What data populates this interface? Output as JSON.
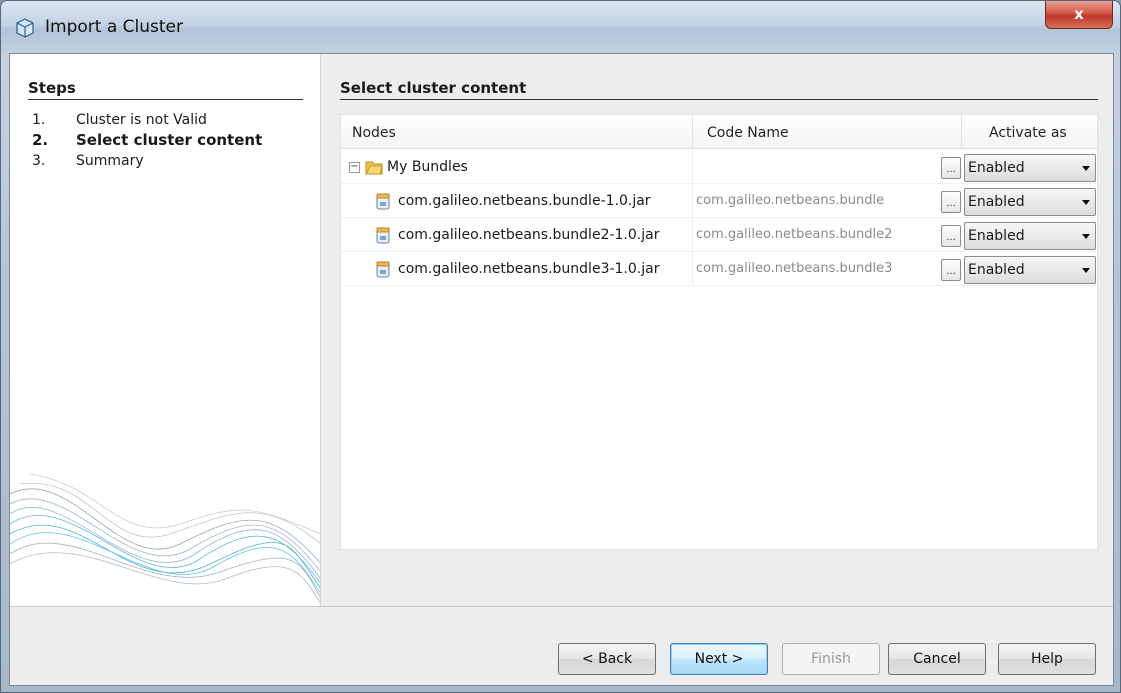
{
  "window": {
    "title": "Import a Cluster",
    "close_label": "x"
  },
  "steps": {
    "title": "Steps",
    "items": [
      {
        "num": "1.",
        "label": "Cluster is not Valid"
      },
      {
        "num": "2.",
        "label": "Select cluster content"
      },
      {
        "num": "3.",
        "label": "Summary"
      }
    ]
  },
  "main": {
    "title": "Select cluster content"
  },
  "table": {
    "columns": [
      "Nodes",
      "Code Name",
      "Activate as"
    ],
    "rows": [
      {
        "node": "My Bundles",
        "code": "",
        "activate": "Enabled",
        "type": "folder"
      },
      {
        "node": "com.galileo.netbeans.bundle-1.0.jar",
        "code": "com.galileo.netbeans.bundle",
        "activate": "Enabled",
        "type": "jar"
      },
      {
        "node": "com.galileo.netbeans.bundle2-1.0.jar",
        "code": "com.galileo.netbeans.bundle2",
        "activate": "Enabled",
        "type": "jar"
      },
      {
        "node": "com.galileo.netbeans.bundle3-1.0.jar",
        "code": "com.galileo.netbeans.bundle3",
        "activate": "Enabled",
        "type": "jar"
      }
    ],
    "ellipsis": "...",
    "expander": "−"
  },
  "buttons": {
    "back": "< Back",
    "next": "Next >",
    "finish": "Finish",
    "cancel": "Cancel",
    "help": "Help"
  },
  "icons": {
    "title": "netbeans-cube-icon",
    "folder": "folder-icon",
    "jar": "jar-icon",
    "dropdown": "chevron-down-icon"
  }
}
